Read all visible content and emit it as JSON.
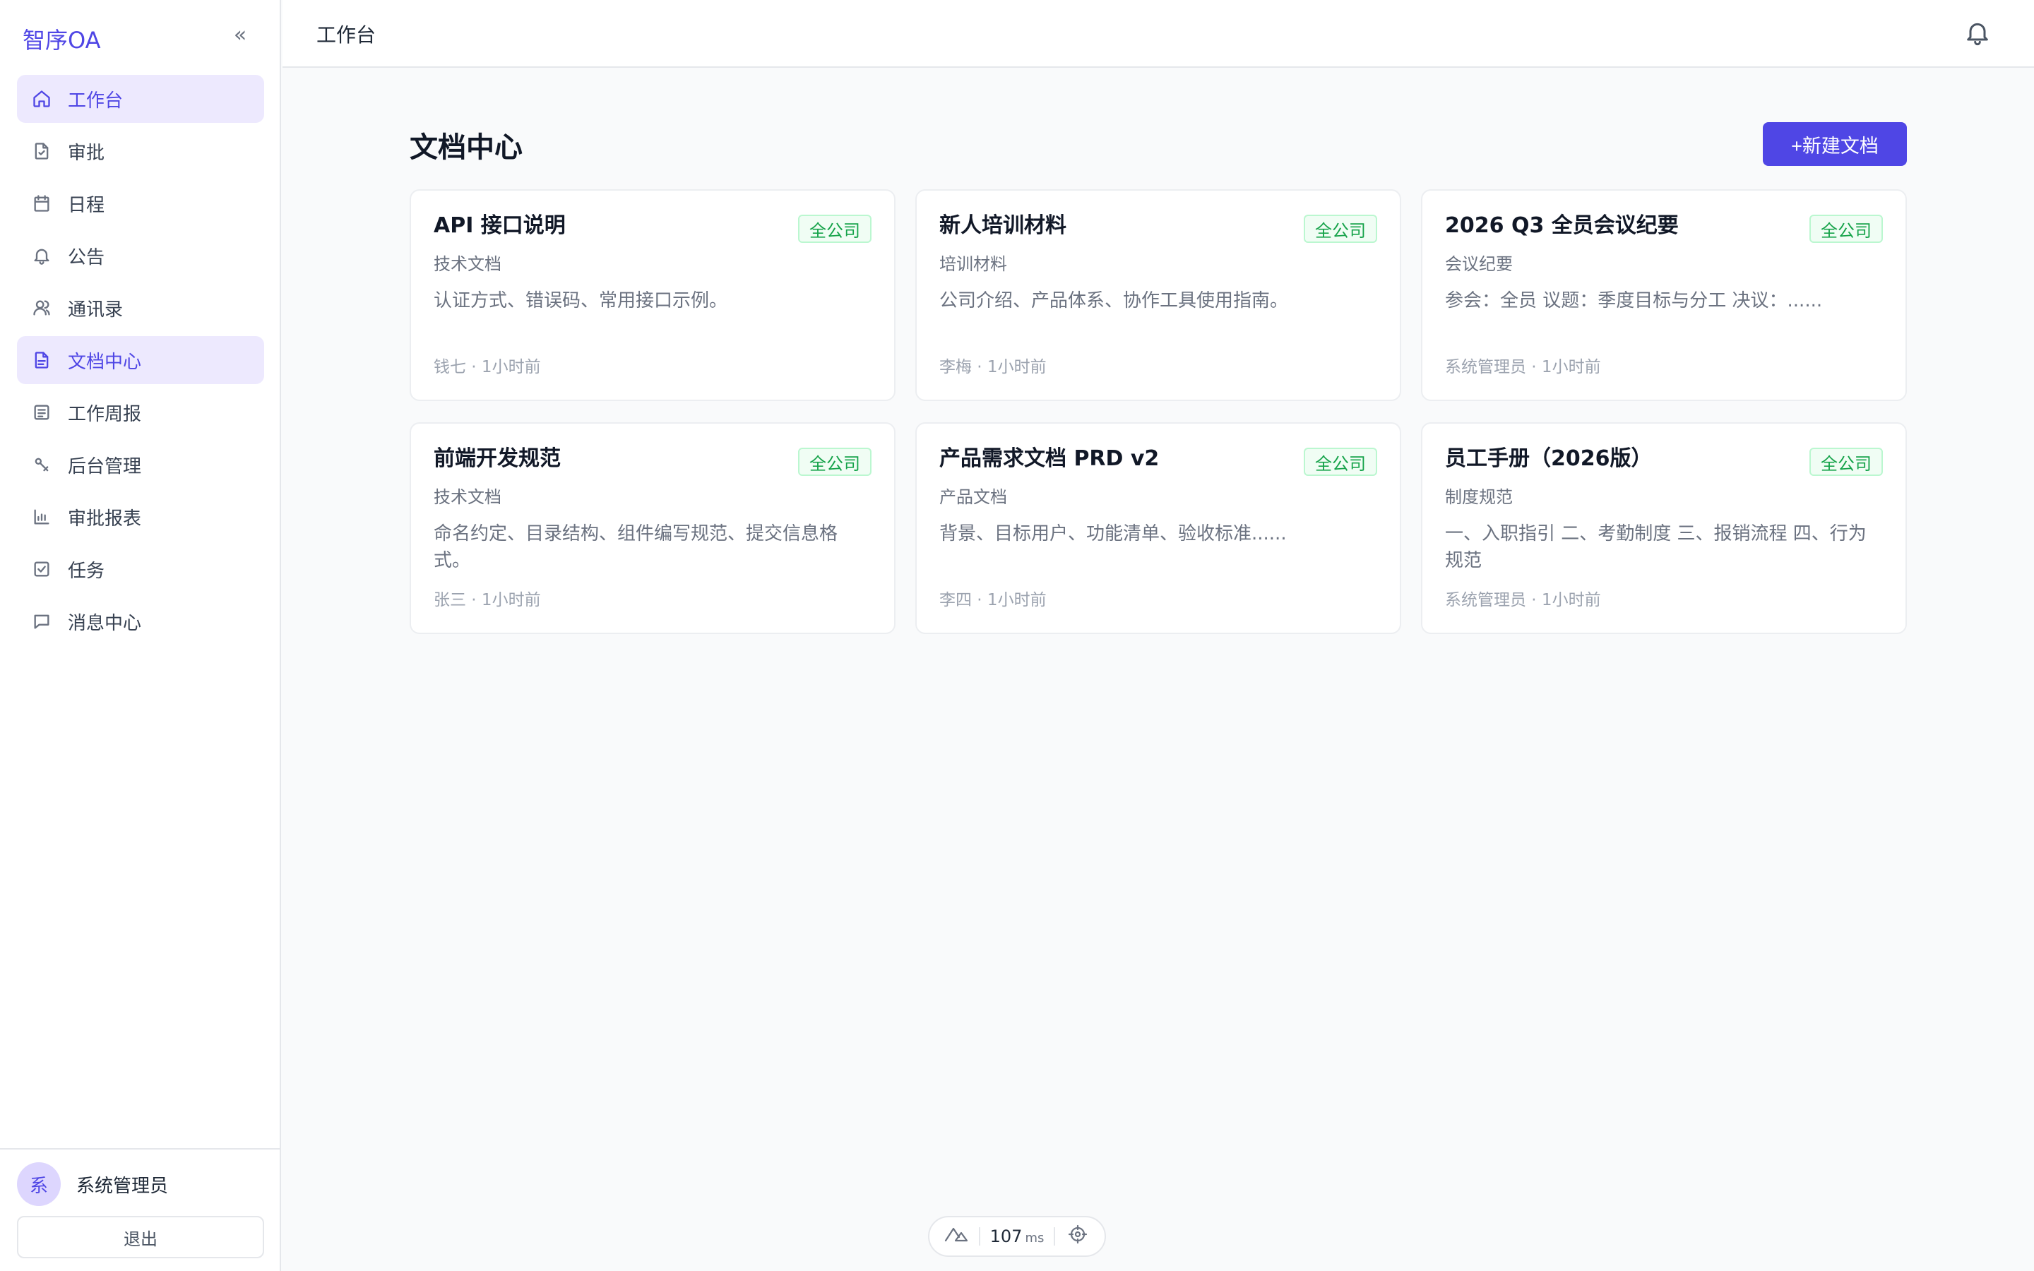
{
  "brand": {
    "name": "智序OA",
    "collapse_icon": "«"
  },
  "sidebar": {
    "items": [
      {
        "label": "工作台",
        "icon": "home-icon",
        "active": true
      },
      {
        "label": "审批",
        "icon": "file-check-icon",
        "active": false
      },
      {
        "label": "日程",
        "icon": "calendar-icon",
        "active": false
      },
      {
        "label": "公告",
        "icon": "bell-icon",
        "active": false
      },
      {
        "label": "通讯录",
        "icon": "users-icon",
        "active": false
      },
      {
        "label": "文档中心",
        "icon": "document-icon",
        "active": true
      },
      {
        "label": "工作周报",
        "icon": "list-icon",
        "active": false
      },
      {
        "label": "后台管理",
        "icon": "wrench-icon",
        "active": false
      },
      {
        "label": "审批报表",
        "icon": "bar-chart-icon",
        "active": false
      },
      {
        "label": "任务",
        "icon": "check-square-icon",
        "active": false
      },
      {
        "label": "消息中心",
        "icon": "message-icon",
        "active": false
      }
    ],
    "user": {
      "avatar": "系",
      "name": "系统管理员"
    },
    "logout_label": "退出"
  },
  "header": {
    "title": "工作台"
  },
  "main": {
    "title": "文档中心",
    "new_doc_label": "+新建文档",
    "cards": [
      {
        "title": "API 接口说明",
        "badge": "全公司",
        "category": "技术文档",
        "desc": "认证方式、错误码、常用接口示例。",
        "meta": "钱七 · 1小时前"
      },
      {
        "title": "新人培训材料",
        "badge": "全公司",
        "category": "培训材料",
        "desc": "公司介绍、产品体系、协作工具使用指南。",
        "meta": "李梅 · 1小时前"
      },
      {
        "title": "2026 Q3 全员会议纪要",
        "badge": "全公司",
        "category": "会议纪要",
        "desc": "参会：全员 议题：季度目标与分工 决议：......",
        "meta": "系统管理员 · 1小时前"
      },
      {
        "title": "前端开发规范",
        "badge": "全公司",
        "category": "技术文档",
        "desc": "命名约定、目录结构、组件编写规范、提交信息格式。",
        "meta": "张三 · 1小时前"
      },
      {
        "title": "产品需求文档 PRD v2",
        "badge": "全公司",
        "category": "产品文档",
        "desc": "背景、目标用户、功能清单、验收标准......",
        "meta": "李四 · 1小时前"
      },
      {
        "title": "员工手册（2026版）",
        "badge": "全公司",
        "category": "制度规范",
        "desc": "一、入职指引 二、考勤制度 三、报销流程 四、行为规范",
        "meta": "系统管理员 · 1小时前"
      }
    ]
  },
  "perf": {
    "value": "107",
    "unit": "ms"
  },
  "colors": {
    "accent": "#4f46e5",
    "active_bg": "#ede9fe",
    "badge_green": "#16a34a"
  }
}
